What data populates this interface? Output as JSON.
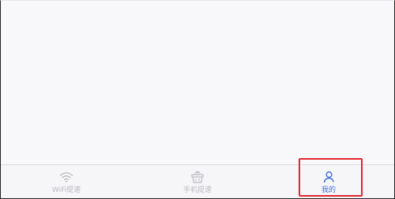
{
  "tabbar": {
    "tabs": [
      {
        "label": "WiFi提速",
        "icon": "wifi-icon",
        "active": false
      },
      {
        "label": "手机提速",
        "icon": "basket-icon",
        "active": false
      },
      {
        "label": "我的",
        "icon": "user-icon",
        "active": true
      }
    ]
  },
  "colors": {
    "active": "#3f6fd9",
    "inactive": "#b9bac0",
    "highlight": "#e3252c",
    "background": "#f8f8fb"
  }
}
